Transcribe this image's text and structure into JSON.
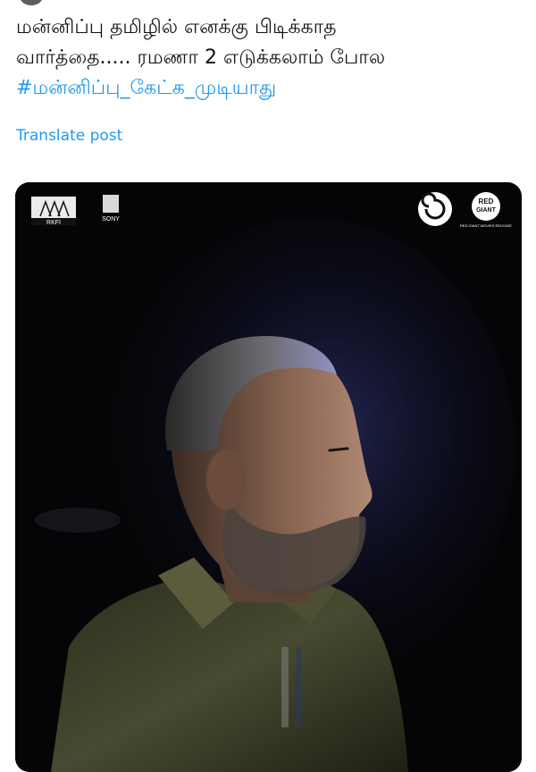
{
  "tweet": {
    "line1": "மன்னிப்பு தமிழில் எனக்கு பிடிக்காத",
    "line2": "வார்த்தை..... ரமணா 2 எடுக்கலாம் போல",
    "hashtag": "#மன்னிப்பு_கேட்க_முடியாது",
    "translate_label": "Translate post"
  },
  "media": {
    "logo_left_1": "RKFI",
    "logo_left_2": "SONY",
    "logo_right_2_top": "RED",
    "logo_right_2_mid": "GIANT",
    "logo_right_2_caption": "RED GIANT MOVIES RELEASE"
  },
  "colors": {
    "link": "#1d9bf0",
    "text": "#0f1419",
    "media_bg": "#050507",
    "shirt": "#3d3f2a"
  }
}
